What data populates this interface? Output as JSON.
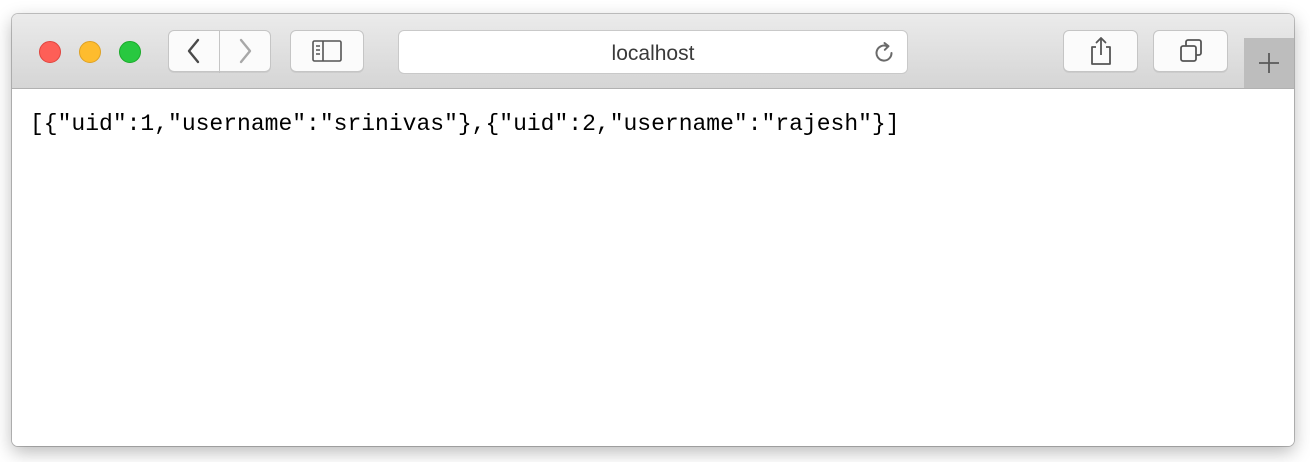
{
  "window": {
    "traffic_lights": [
      "close",
      "minimize",
      "zoom"
    ]
  },
  "toolbar": {
    "back_icon": "chevron-left-icon",
    "forward_icon": "chevron-right-icon",
    "sidebar_icon": "sidebar-icon",
    "share_icon": "share-icon",
    "tabs_icon": "tab-overview-icon",
    "new_tab_icon": "plus-icon"
  },
  "address_bar": {
    "text": "localhost",
    "reload_icon": "reload-icon"
  },
  "page": {
    "body_text": "[{\"uid\":1,\"username\":\"srinivas\"},{\"uid\":2,\"username\":\"rajesh\"}]"
  },
  "colors": {
    "close": "#fe5f57",
    "minimize": "#febc2e",
    "zoom": "#28c840"
  }
}
